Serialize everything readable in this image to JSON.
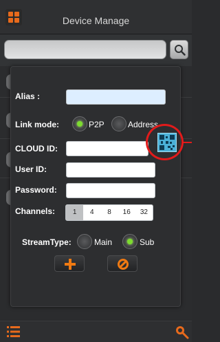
{
  "header": {
    "title": "Device Manage",
    "menu_icon": "grid-menu-icon"
  },
  "search": {
    "value": "",
    "button_icon": "search-icon"
  },
  "dialog": {
    "alias_label": "Alias :",
    "alias_value": "",
    "link_mode_label": "Link mode:",
    "link_options": [
      "P2P",
      "Address"
    ],
    "link_selected": "P2P",
    "cloud_id_label": "CLOUD ID:",
    "cloud_id_value": "",
    "qr_icon": "qr-code-icon",
    "user_id_label": "User ID:",
    "user_id_value": "",
    "password_label": "Password:",
    "password_value": "",
    "channels_label": "Channels:",
    "channel_options": [
      "1",
      "4",
      "8",
      "16",
      "32"
    ],
    "channel_selected": "1",
    "stream_label": "StreamType:",
    "stream_options": [
      "Main",
      "Sub"
    ],
    "stream_selected": "Sub",
    "add_icon": "plus-icon",
    "cancel_icon": "cancel-icon"
  },
  "colors": {
    "accent": "#e86a1c",
    "radio_on": "#7ddc2f",
    "annotation": "#e21b1b",
    "qr": "#4bb1d8"
  },
  "bottom": {
    "left_icon": "list-menu-icon",
    "right_icon": "camera-search-icon"
  }
}
